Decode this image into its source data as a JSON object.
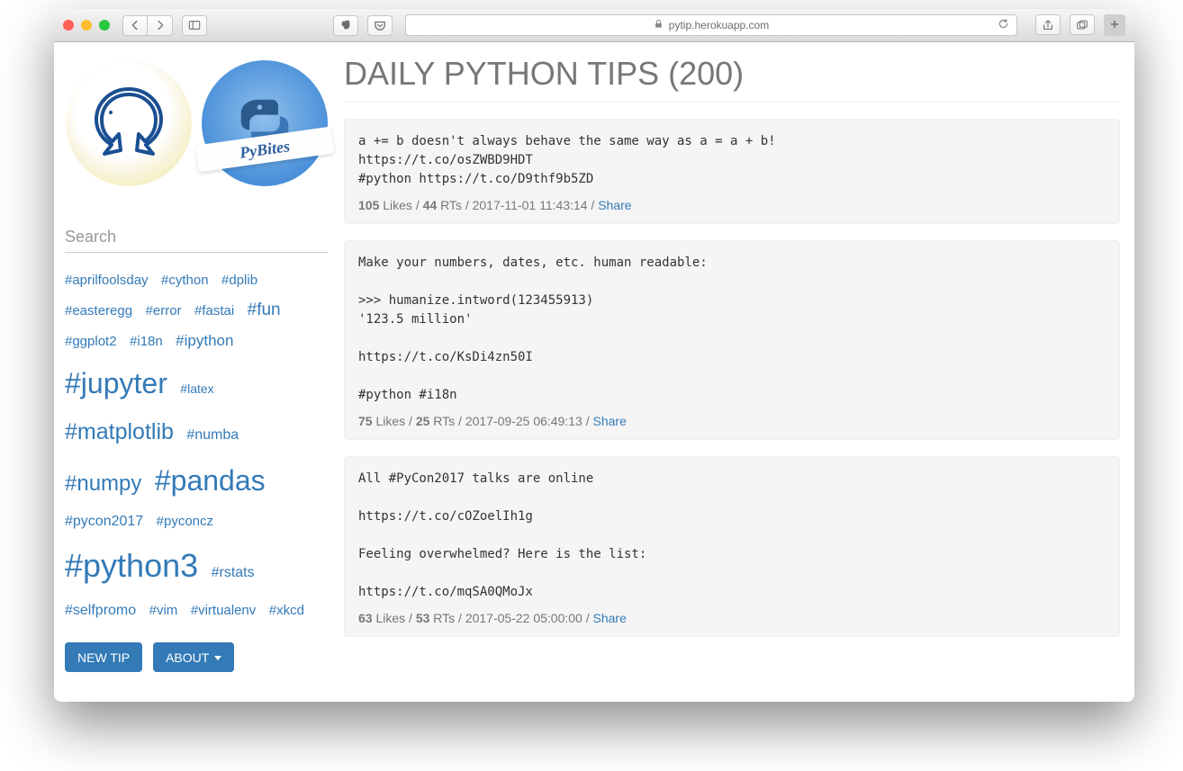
{
  "chrome": {
    "url_display": "pytip.herokuapp.com",
    "traffic": {
      "close": "",
      "min": "",
      "max": ""
    }
  },
  "logos": {
    "pybites_ribbon": "PyBites"
  },
  "search": {
    "placeholder": "Search",
    "value": ""
  },
  "tags": [
    {
      "label": "#aprilfoolsday",
      "size": 15
    },
    {
      "label": "#cython",
      "size": 15
    },
    {
      "label": "#dplib",
      "size": 15
    },
    {
      "label": "#easteregg",
      "size": 15
    },
    {
      "label": "#error",
      "size": 15
    },
    {
      "label": "#fastai",
      "size": 15
    },
    {
      "label": "#fun",
      "size": 19
    },
    {
      "label": "#ggplot2",
      "size": 15
    },
    {
      "label": "#i18n",
      "size": 15
    },
    {
      "label": "#ipython",
      "size": 17
    },
    {
      "label": "#jupyter",
      "size": 32
    },
    {
      "label": "#latex",
      "size": 14
    },
    {
      "label": "#matplotlib",
      "size": 25
    },
    {
      "label": "#numba",
      "size": 16
    },
    {
      "label": "#numpy",
      "size": 24
    },
    {
      "label": "#pandas",
      "size": 32
    },
    {
      "label": "#pycon2017",
      "size": 16
    },
    {
      "label": "#pyconcz",
      "size": 15
    },
    {
      "label": "#python3",
      "size": 36
    },
    {
      "label": "#rstats",
      "size": 16
    },
    {
      "label": "#selfpromo",
      "size": 16
    },
    {
      "label": "#vim",
      "size": 15
    },
    {
      "label": "#virtualenv",
      "size": 15
    },
    {
      "label": "#xkcd",
      "size": 15
    }
  ],
  "buttons": {
    "new_tip": "NEW TIP",
    "about": "ABOUT"
  },
  "title": "DAILY PYTHON TIPS (200)",
  "meta_labels": {
    "likes": "Likes",
    "rts": "RTs",
    "share": "Share",
    "sep": " / "
  },
  "tips": [
    {
      "body": "a += b doesn't always behave the same way as a = a + b!\nhttps://t.co/osZWBD9HDT\n#python https://t.co/D9thf9b5ZD",
      "likes": "105",
      "rts": "44",
      "timestamp": "2017-11-01 11:43:14"
    },
    {
      "body": "Make your numbers, dates, etc. human readable:\n\n>>> humanize.intword(123455913)\n'123.5 million'\n\nhttps://t.co/KsDi4zn50I\n\n#python #i18n",
      "likes": "75",
      "rts": "25",
      "timestamp": "2017-09-25 06:49:13"
    },
    {
      "body": "All #PyCon2017 talks are online\n\nhttps://t.co/cOZoelIh1g\n\nFeeling overwhelmed? Here is the list:\n\nhttps://t.co/mqSA0QMoJx",
      "likes": "63",
      "rts": "53",
      "timestamp": "2017-05-22 05:00:00"
    }
  ]
}
